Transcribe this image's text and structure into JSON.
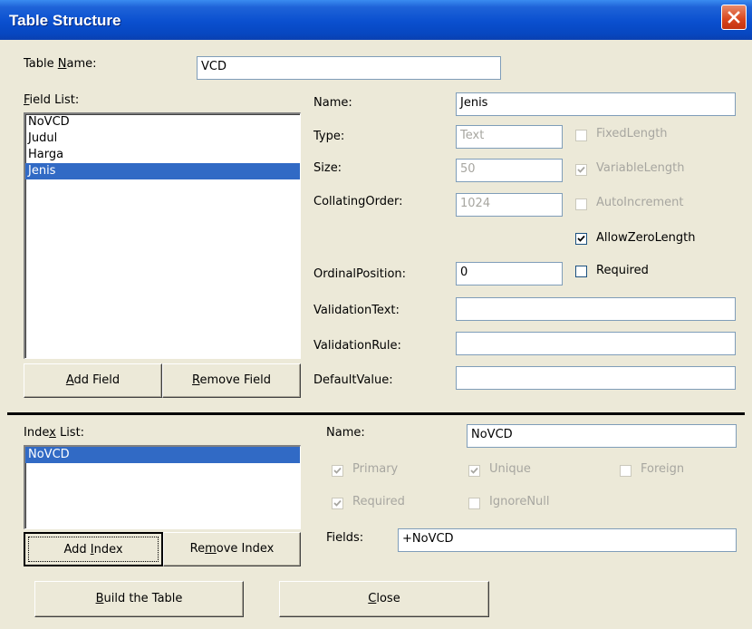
{
  "window": {
    "title": "Table Structure"
  },
  "table": {
    "name_label": "Table Name:",
    "name_value": "VCD"
  },
  "fields": {
    "list_label": "Field List:",
    "items": [
      "NoVCD",
      "Judul",
      "Harga",
      "Jenis"
    ],
    "selected_index": 3,
    "add_button": "Add Field",
    "remove_button": "Remove Field"
  },
  "field_props": {
    "name_label": "Name:",
    "name_value": "Jenis",
    "type_label": "Type:",
    "type_value": "Text",
    "size_label": "Size:",
    "size_value": "50",
    "collating_label": "CollatingOrder:",
    "collating_value": "1024",
    "ordinal_label": "OrdinalPosition:",
    "ordinal_value": "0",
    "validation_text_label": "ValidationText:",
    "validation_text_value": "",
    "validation_rule_label": "ValidationRule:",
    "validation_rule_value": "",
    "default_label": "DefaultValue:",
    "default_value": "",
    "fixed_length": {
      "label": "FixedLength",
      "checked": false,
      "enabled": false
    },
    "variable_length": {
      "label": "VariableLength",
      "checked": true,
      "enabled": false
    },
    "auto_increment": {
      "label": "AutoIncrement",
      "checked": false,
      "enabled": false
    },
    "allow_zero_length": {
      "label": "AllowZeroLength",
      "checked": true,
      "enabled": true
    },
    "required": {
      "label": "Required",
      "checked": false,
      "enabled": true
    }
  },
  "indexes": {
    "list_label": "Index List:",
    "items": [
      "NoVCD"
    ],
    "selected_index": 0,
    "add_button": "Add Index",
    "remove_button": "Remove Index"
  },
  "index_props": {
    "name_label": "Name:",
    "name_value": "NoVCD",
    "primary": {
      "label": "Primary",
      "checked": true,
      "enabled": false
    },
    "unique": {
      "label": "Unique",
      "checked": true,
      "enabled": false
    },
    "foreign": {
      "label": "Foreign",
      "checked": false,
      "enabled": false
    },
    "required": {
      "label": "Required",
      "checked": true,
      "enabled": false
    },
    "ignore_null": {
      "label": "IgnoreNull",
      "checked": false,
      "enabled": false
    },
    "fields_label": "Fields:",
    "fields_value": "+NoVCD"
  },
  "footer": {
    "build_button": "Build the Table",
    "close_button": "Close"
  },
  "colors": {
    "title_bar": "#0A4FCF",
    "selection": "#316AC5",
    "dialog_bg": "#ECE9D8"
  }
}
